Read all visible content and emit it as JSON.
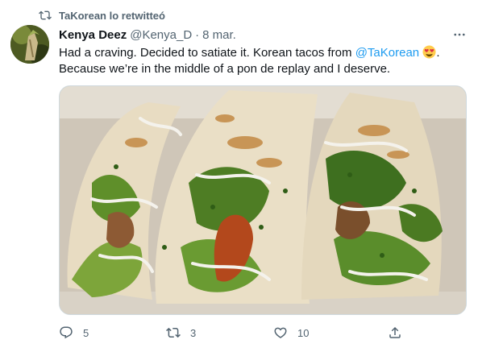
{
  "retweet": {
    "text": "TaKorean lo retwitteó"
  },
  "tweet": {
    "author_name": "Kenya Deez",
    "author_handle": "@Kenya_D",
    "separator": "·",
    "time": "8 mar.",
    "text_part1": "Had a craving. Decided to satiate it. Korean tacos from ",
    "mention": "@TaKorean",
    "text_part2": ".",
    "text_line2": "Because we’re in the middle of a pon de replay and I deserve.",
    "emoji": "heart-eyes-emoji"
  },
  "actions": {
    "reply_count": "5",
    "retweet_count": "3",
    "like_count": "10"
  },
  "icons": {
    "retweet": "retweet-icon",
    "more": "more-icon",
    "reply": "reply-icon",
    "like": "like-icon",
    "share": "share-icon"
  },
  "colors": {
    "text": "#0f1419",
    "secondary": "#536471",
    "accent": "#1d9bf0",
    "border": "#cfd9de"
  }
}
